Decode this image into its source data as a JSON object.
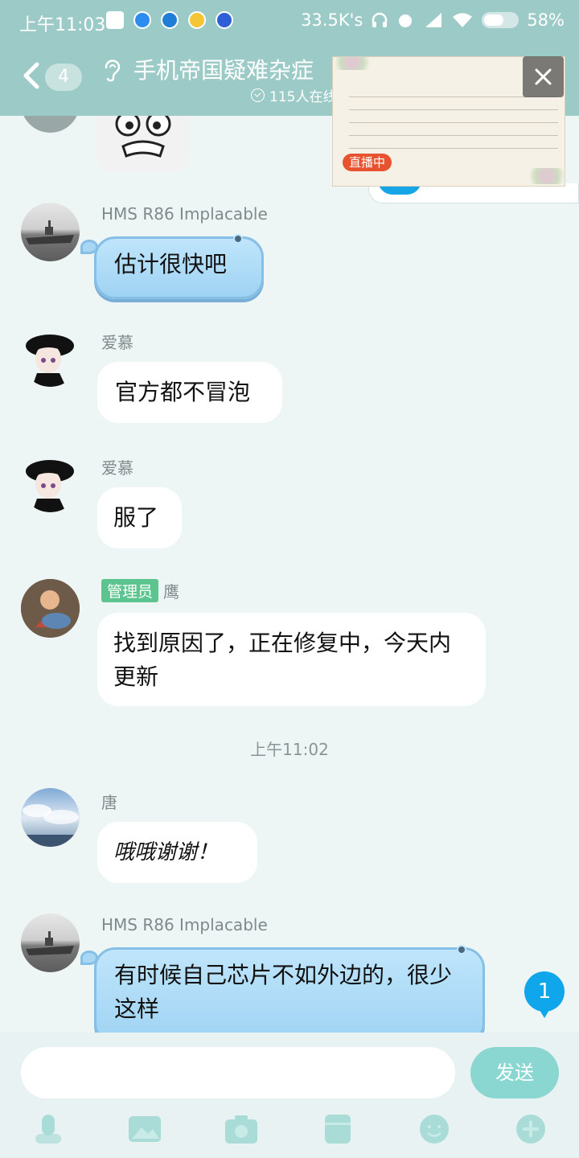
{
  "status_bar": {
    "time": "上午11:03",
    "network_speed": "33.5K's",
    "battery": "58%"
  },
  "header": {
    "back_count": "4",
    "title": "手机帝国疑难杂症",
    "online": "115人在线"
  },
  "live": {
    "tag": "直播中"
  },
  "messages": [
    {
      "sender": "HMS R86 Implacable",
      "text": "估计很快吧",
      "style": "blue"
    },
    {
      "sender": "爱慕",
      "text": "官方都不冒泡",
      "style": "white"
    },
    {
      "sender": "爱慕",
      "text": "服了",
      "style": "white"
    },
    {
      "badge": "管理员",
      "sender": "鹰",
      "text": "找到原因了，正在修复中，今天内更新",
      "style": "white"
    },
    {
      "sender": "唐",
      "text": "哦哦谢谢！",
      "style": "handwriting"
    },
    {
      "sender": "HMS R86 Implacable",
      "text": "有时候自己芯片不如外边的，很少这样",
      "style": "blue"
    }
  ],
  "timestamp": "上午11:02",
  "unread_count": "1",
  "composer": {
    "placeholder": "",
    "send_label": "发送"
  },
  "toolbar_icons": [
    "mic-icon",
    "image-icon",
    "camera-icon",
    "file-icon",
    "emoji-icon",
    "plus-icon"
  ],
  "colors": {
    "header": "#9ccbc7",
    "background": "#eef5f5",
    "admin_badge": "#5cc48e",
    "send_button": "#8ad7d2",
    "unread_badge": "#10a6ec",
    "live_tag": "#e8532f"
  }
}
